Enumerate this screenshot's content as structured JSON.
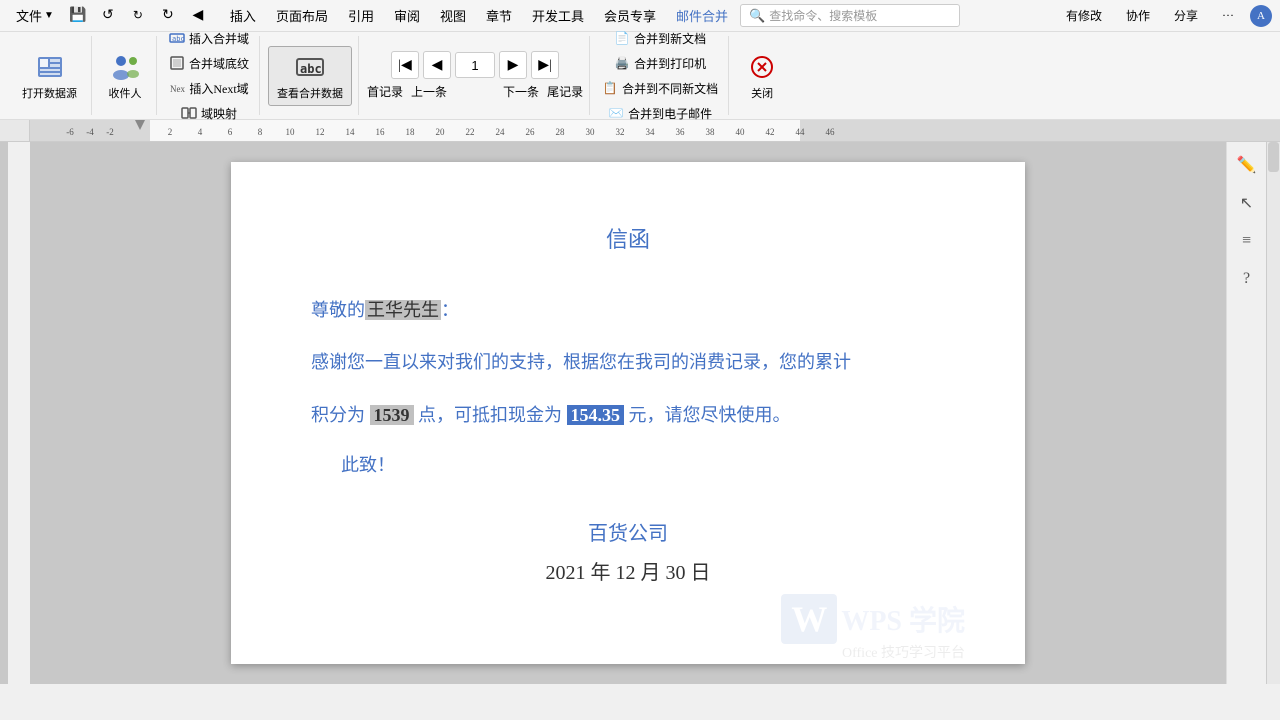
{
  "menubar": {
    "dropdown_label": "文件",
    "items": [
      "文件",
      "插入",
      "页面布局",
      "引用",
      "审阅",
      "视图",
      "章节",
      "开发工具",
      "会员专享",
      "邮件合并"
    ],
    "quick_actions": [
      "保存",
      "撤销",
      "恢复",
      "重复"
    ],
    "search_placeholder": "查找命令、搜索模板",
    "right_actions": [
      "有修改",
      "协作",
      "分享",
      "更多"
    ]
  },
  "toolbar": {
    "groups": [
      {
        "name": "打开数据源",
        "icon": "📊",
        "sub_items": [
          "打开数据源"
        ]
      },
      {
        "name": "收件人",
        "icon": "👤"
      },
      {
        "name": "插入合并域",
        "icon": "📝",
        "sub_label": "插入合并域"
      },
      {
        "name": "合并域底纹",
        "icon": "🔲",
        "sub_label": "合并域底纹"
      },
      {
        "name": "查看合并数据",
        "icon": "abc",
        "sub_label": "查看合并数据"
      },
      {
        "name": "插入Next域",
        "sub_label": "插入Next域"
      },
      {
        "name": "域映射",
        "sub_label": "域映射"
      }
    ],
    "nav": {
      "first": "首记录",
      "prev": "上一条",
      "page": "1",
      "next": "下一条",
      "last": "尾记录"
    },
    "merge_actions": [
      "合并到新文档",
      "合并到打印机",
      "合并到不同新文档",
      "合并到电子邮件"
    ],
    "close_label": "关闭"
  },
  "ruler": {
    "marks": [
      "-6",
      "-4",
      "-2",
      "2",
      "4",
      "6",
      "8",
      "10",
      "12",
      "14",
      "16",
      "18",
      "20",
      "22",
      "24",
      "26",
      "28",
      "30",
      "32",
      "34",
      "36",
      "38",
      "40",
      "42",
      "44",
      "46"
    ]
  },
  "document": {
    "title": "信函",
    "greeting": "尊敬的",
    "greeting_name": "王华先生",
    "greeting_end": "：",
    "body_line1": "感谢您一直以来对我们的支持，根据您在我司的消费记录，您的累计",
    "body_line2_pre": "积分为",
    "body_line2_points": "1539",
    "body_line2_mid": "点，可抵扣现金为",
    "body_line2_amount": "154.35",
    "body_line2_end": "元，请您尽快使用。",
    "closing": "此致！",
    "signature": "百货公司",
    "date": "2021 年 12 月 30 日"
  },
  "sidebar": {
    "tools": [
      "edit",
      "selection",
      "align",
      "help"
    ]
  },
  "wps": {
    "logo": "W",
    "brand": "WPS 学院",
    "sub": "Office 技巧学习平台"
  }
}
